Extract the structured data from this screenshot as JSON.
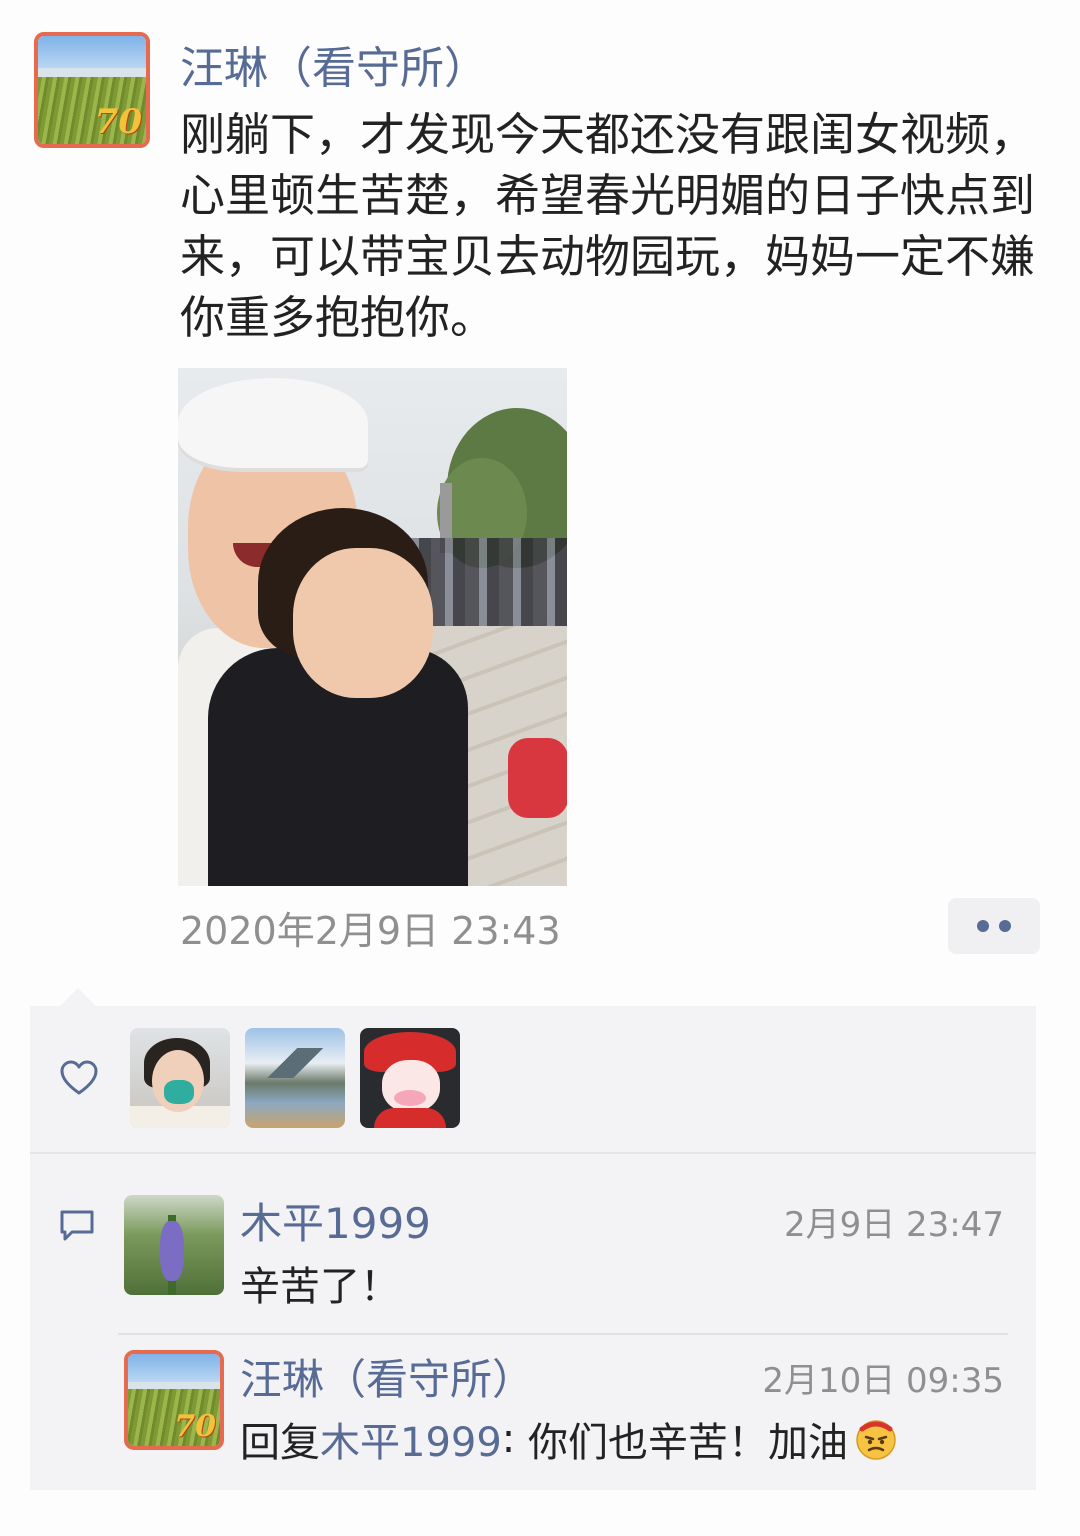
{
  "post": {
    "author": "汪琳（看守所）",
    "text": "刚躺下，才发现今天都还没有跟闺女视频，心里顿生苦楚，希望春光明媚的日子快点到来，可以带宝贝去动物园玩，妈妈一定不嫌你重多抱抱你。",
    "timestamp": "2020年2月9日 23:43",
    "avatar_badge": "70"
  },
  "likes": {
    "icon": "heart-icon",
    "count": 3
  },
  "comments": [
    {
      "name": "木平1999",
      "time": "2月9日 23:47",
      "text": "辛苦了！"
    },
    {
      "name": "汪琳（看守所）",
      "time": "2月10日 09:35",
      "reply_prefix": "回复",
      "reply_to": "木平1999",
      "reply_sep": ": ",
      "text": "你们也辛苦！加油",
      "emoji": "grimacing-face-emoji",
      "avatar_badge": "70"
    }
  ],
  "colors": {
    "link": "#576b95",
    "muted": "#8f8f8f",
    "panel": "#f3f3f5"
  }
}
